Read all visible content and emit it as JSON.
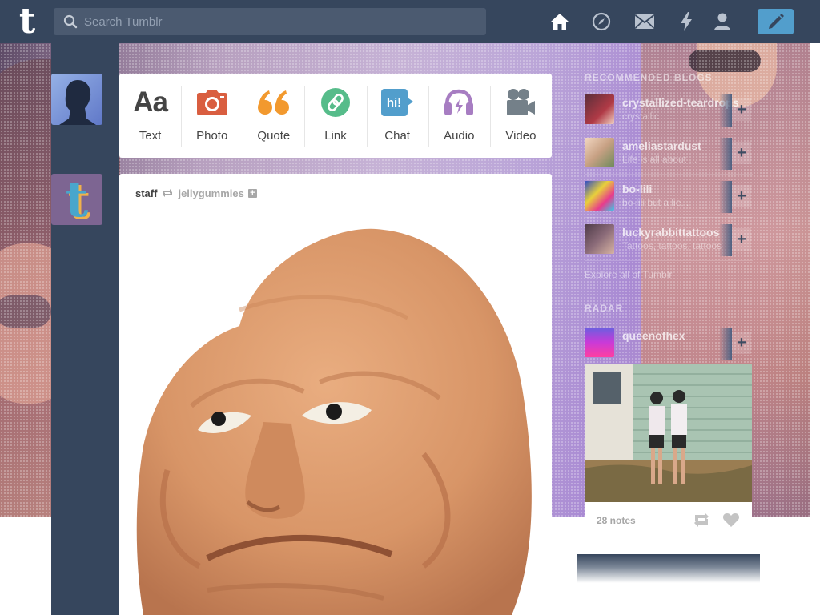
{
  "header": {
    "logo": "t",
    "search_placeholder": "Search Tumblr",
    "nav_icons": [
      "home-icon",
      "compass-icon",
      "mail-icon",
      "lightning-icon",
      "person-icon"
    ],
    "compose_icon": "pencil-icon"
  },
  "post_types": [
    {
      "label": "Text",
      "icon": "text-icon",
      "color": "#444444"
    },
    {
      "label": "Photo",
      "icon": "camera-icon",
      "color": "#d95e40"
    },
    {
      "label": "Quote",
      "icon": "quote-icon",
      "color": "#f2992e"
    },
    {
      "label": "Link",
      "icon": "link-icon",
      "color": "#56bc8a"
    },
    {
      "label": "Chat",
      "icon": "chat-icon",
      "color": "#529ecc"
    },
    {
      "label": "Audio",
      "icon": "headphones-icon",
      "color": "#a77dc2"
    },
    {
      "label": "Video",
      "icon": "video-camera-icon",
      "color": "#748089"
    }
  ],
  "post": {
    "author": "staff",
    "source": "jellygummies",
    "follow_symbol": "+"
  },
  "sidebar": {
    "recommended_heading": "Recommended Blogs",
    "blogs": [
      {
        "name": "crystallized-teardrops",
        "title": "crystallic",
        "avatar_color": "#b03a46"
      },
      {
        "name": "ameliastardust",
        "title": "Life is all about ...",
        "avatar_color": "#c7a083"
      },
      {
        "name": "bo-lili",
        "title": "bo-lili but a lie...",
        "avatar_color": "#e8d03b"
      },
      {
        "name": "luckyrabbittattoos",
        "title": "Tattoos, tattoos, tattoos",
        "avatar_color": "#8a6a78"
      }
    ],
    "plus_symbol": "+",
    "explore": "Explore all of Tumblr",
    "radar_heading": "Radar",
    "radar_blog": {
      "name": "queenofhex",
      "avatar_color": "#c93ad8"
    },
    "radar_notes": "28 notes"
  },
  "colors": {
    "header_bg": "#36465d",
    "compose_bg": "#529ecc",
    "link_blue": "#529ecc"
  }
}
